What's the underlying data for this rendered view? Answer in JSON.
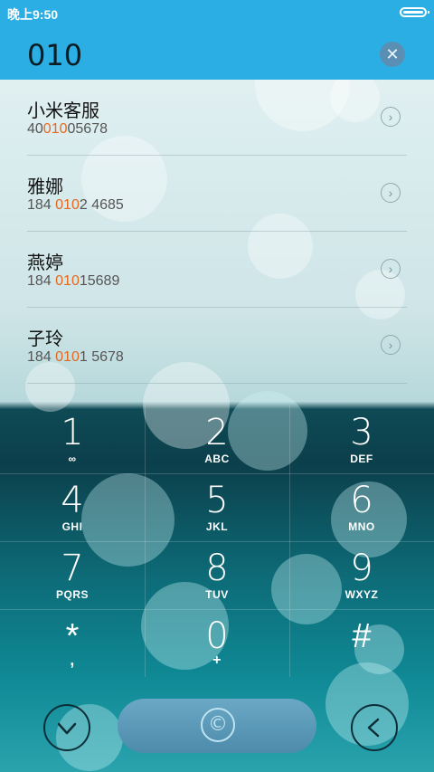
{
  "status": {
    "time": "晚上9:50"
  },
  "search": {
    "query": "010",
    "clear_icon": "✕"
  },
  "contacts": [
    {
      "name": "小米客服",
      "num_pre": "40",
      "num_hl": "010",
      "num_post": "05678"
    },
    {
      "name": "雅娜",
      "num_pre": "184 ",
      "num_hl": "010",
      "num_post": "2 4685"
    },
    {
      "name": "燕婷",
      "num_pre": "184 ",
      "num_hl": "010",
      "num_post": "15689"
    },
    {
      "name": "子玲",
      "num_pre": "184 ",
      "num_hl": "010",
      "num_post": "1 5678"
    }
  ],
  "keys": [
    {
      "digit": "1",
      "letters": "∞"
    },
    {
      "digit": "2",
      "letters": "ABC"
    },
    {
      "digit": "3",
      "letters": "DEF"
    },
    {
      "digit": "4",
      "letters": "GHI"
    },
    {
      "digit": "5",
      "letters": "JKL"
    },
    {
      "digit": "6",
      "letters": "MNO"
    },
    {
      "digit": "7",
      "letters": "PQRS"
    },
    {
      "digit": "8",
      "letters": "TUV"
    },
    {
      "digit": "9",
      "letters": "WXYZ"
    },
    {
      "digit": "*",
      "letters": ","
    },
    {
      "digit": "0",
      "letters": "+"
    },
    {
      "digit": "#",
      "letters": ""
    }
  ],
  "bottom": {
    "collapse_icon": "chevron-down-icon",
    "call_icon": "copyright-call-icon",
    "backspace_icon": "chevron-left-icon",
    "call_symbol": "©"
  },
  "colors": {
    "header": "#2aaee4",
    "highlight": "#e4681f"
  }
}
